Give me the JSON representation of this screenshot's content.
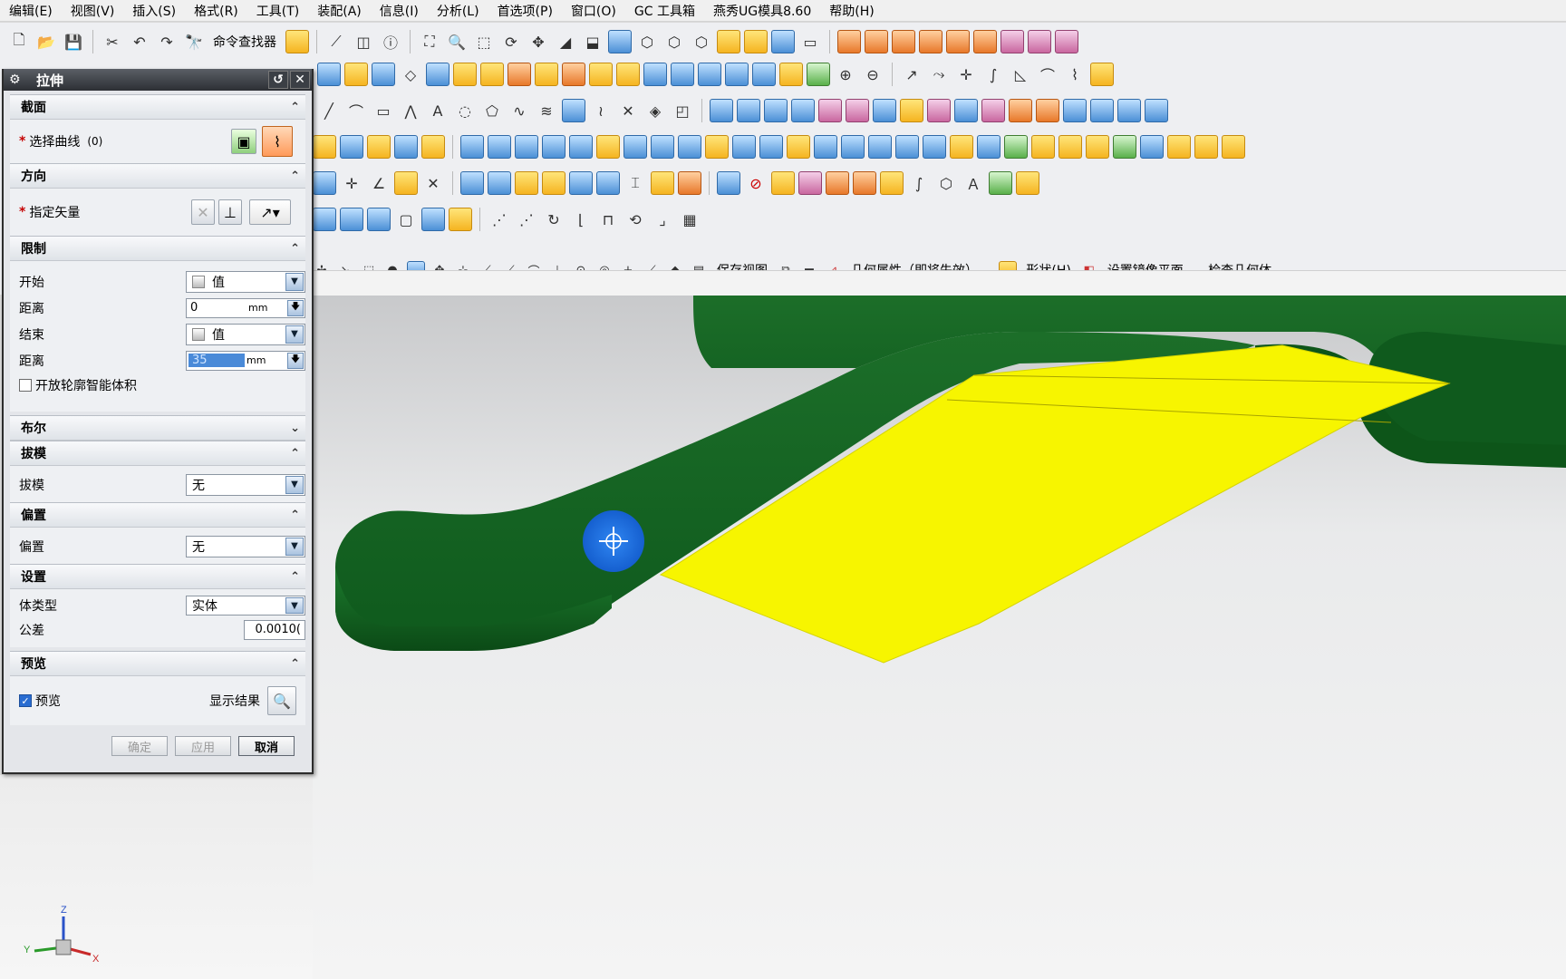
{
  "menu": [
    "编辑(E)",
    "视图(V)",
    "插入(S)",
    "格式(R)",
    "工具(T)",
    "装配(A)",
    "信息(I)",
    "分析(L)",
    "首选项(P)",
    "窗口(O)",
    "GC 工具箱",
    "燕秀UG模具8.60",
    "帮助(H)"
  ],
  "toolbar": {
    "command_finder": "命令查找器",
    "context_items": [
      "保存视图",
      "几何属性（即将失效）...",
      "形状(H)",
      "设置镜像平面...",
      "检查几何体"
    ]
  },
  "dialog": {
    "title": "拉伸",
    "sections": {
      "section": {
        "title": "截面",
        "select_curve_label": "选择曲线",
        "select_curve_count": "(0)"
      },
      "direction": {
        "title": "方向",
        "specify_vector_label": "指定矢量"
      },
      "limits": {
        "title": "限制",
        "start_label": "开始",
        "start_value": "值",
        "start_distance_label": "距离",
        "start_distance": "0",
        "end_label": "结束",
        "end_value": "值",
        "end_distance_label": "距离",
        "end_distance": "35",
        "unit": "mm",
        "open_profile_label": "开放轮廓智能体积"
      },
      "boolean": {
        "title": "布尔"
      },
      "draft": {
        "title": "拔模",
        "label": "拔模",
        "value": "无"
      },
      "offset": {
        "title": "偏置",
        "label": "偏置",
        "value": "无"
      },
      "settings": {
        "title": "设置",
        "body_type_label": "体类型",
        "body_type_value": "实体",
        "tolerance_label": "公差",
        "tolerance_value": "0.0010("
      },
      "preview": {
        "title": "预览",
        "preview_label": "预览",
        "show_result_label": "显示结果"
      }
    },
    "buttons": {
      "ok": "确定",
      "apply": "应用",
      "cancel": "取消"
    }
  },
  "triad": {
    "z": "Z",
    "y": "Y",
    "x": "X"
  },
  "colors": {
    "part_green": "#1f7a2e",
    "face_yellow": "#f7f500",
    "cursor_blue": "#1f6fe0"
  }
}
